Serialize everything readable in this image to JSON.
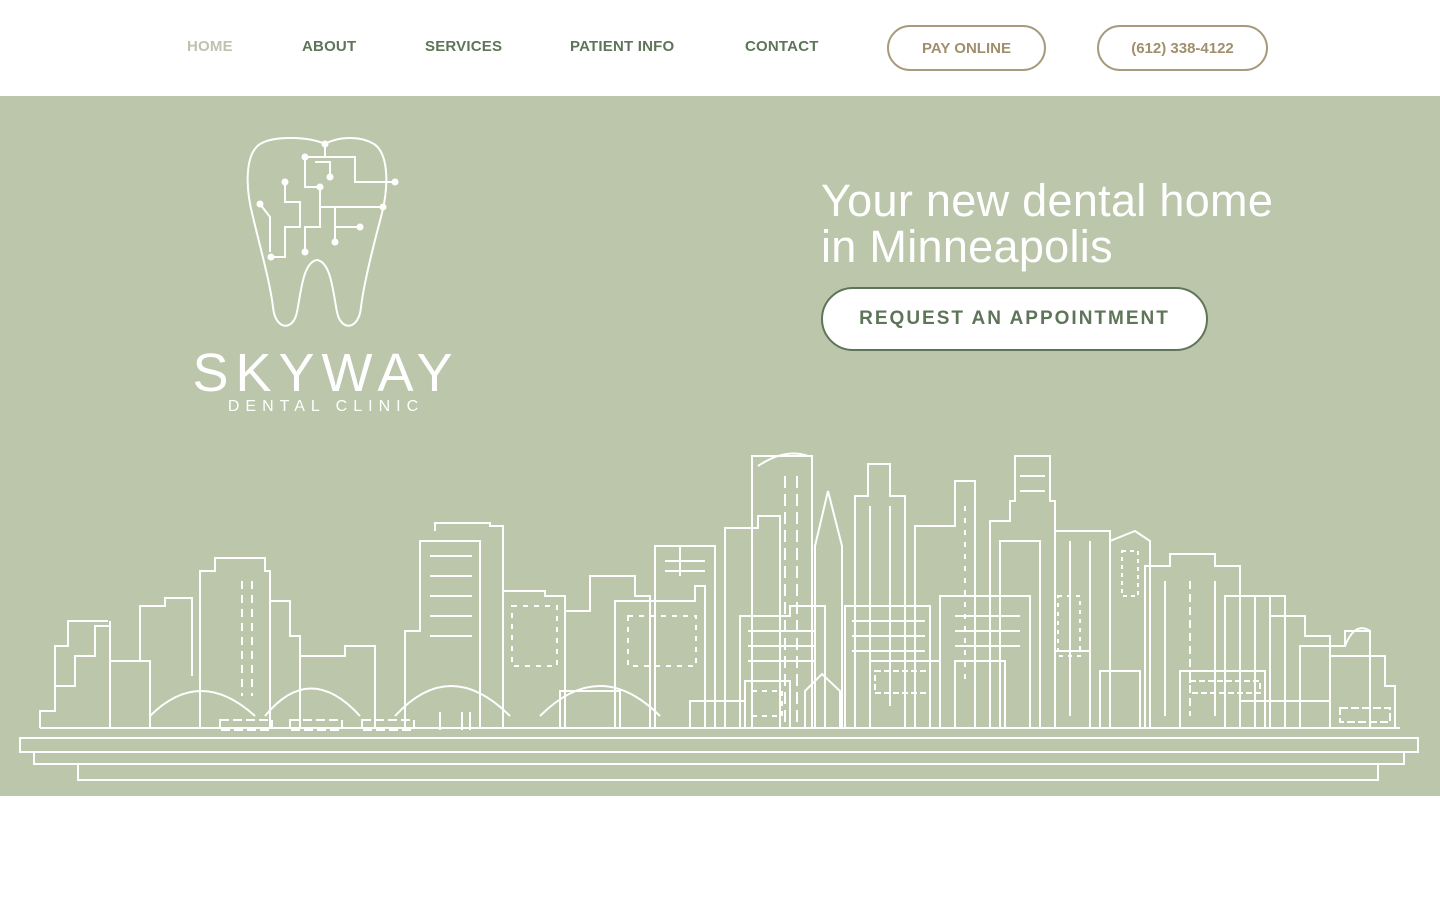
{
  "nav": {
    "items": [
      {
        "label": "HOME",
        "active": true
      },
      {
        "label": "ABOUT",
        "active": false
      },
      {
        "label": "SERVICES",
        "active": false
      },
      {
        "label": "PATIENT INFO",
        "active": false
      },
      {
        "label": "CONTACT",
        "active": false
      }
    ],
    "pay_label": "PAY ONLINE",
    "phone_label": "(612) 338-4122"
  },
  "hero": {
    "headline_line1": "Your new dental home",
    "headline_line2": "in Minneapolis",
    "cta_label": "REQUEST AN APPOINTMENT"
  },
  "brand": {
    "name": "SKYWAY",
    "tagline": "DENTAL CLINIC",
    "logo_icon": "tooth-circuit-icon"
  },
  "illustration": {
    "name": "minneapolis-skyline-illustration"
  },
  "colors": {
    "hero_bg": "#bbc6aa",
    "nav_text": "#5e7559",
    "nav_active": "#bcc4ad",
    "pill_border": "#a89a7c",
    "pill_text": "#a08f6d"
  }
}
